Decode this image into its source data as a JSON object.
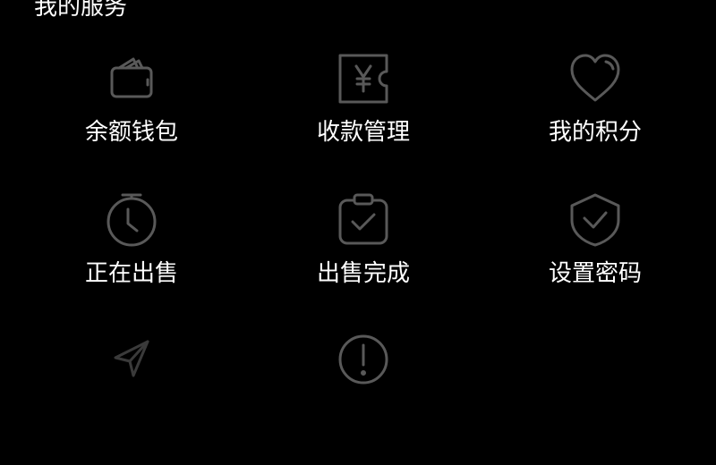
{
  "section": {
    "title": "我的服务"
  },
  "colors": {
    "background": "#000000",
    "text": "#ffffff",
    "icon_stroke": "#595959"
  },
  "services": [
    {
      "label": "余额钱包",
      "icon": "wallet-icon"
    },
    {
      "label": "收款管理",
      "icon": "yen-ticket-icon"
    },
    {
      "label": "我的积分",
      "icon": "heart-icon"
    },
    {
      "label": "正在出售",
      "icon": "stopwatch-icon"
    },
    {
      "label": "出售完成",
      "icon": "clipboard-check-icon"
    },
    {
      "label": "设置密码",
      "icon": "shield-check-icon"
    },
    {
      "label": "",
      "icon": "send-icon"
    },
    {
      "label": "",
      "icon": "alert-circle-icon"
    }
  ]
}
